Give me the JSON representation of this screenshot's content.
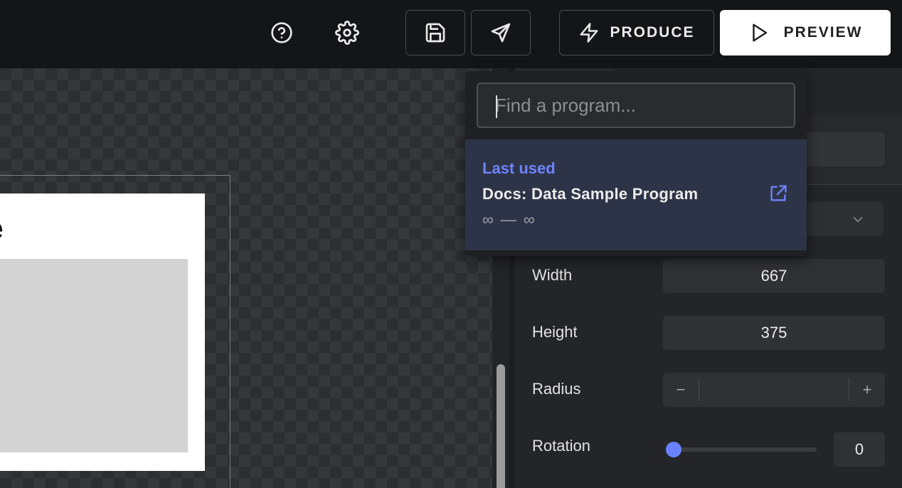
{
  "toolbar": {
    "produce_label": "PRODUCE",
    "preview_label": "PREVIEW"
  },
  "canvas": {
    "card_title_partial": "e"
  },
  "popover": {
    "search_placeholder": "Find a program...",
    "result": {
      "tag": "Last used",
      "name": "Docs: Data Sample Program",
      "range": "∞ — ∞"
    }
  },
  "properties": {
    "width_label": "Width",
    "width_value": "667",
    "height_label": "Height",
    "height_value": "375",
    "radius_label": "Radius",
    "radius_minus": "−",
    "radius_plus": "+",
    "rotation_label": "Rotation",
    "rotation_value": "0"
  },
  "colors": {
    "accent": "#6d84ff",
    "topbar_bg": "#141517",
    "panel_bg": "#242528"
  },
  "icons": [
    "help-icon",
    "gear-icon",
    "save-icon",
    "send-icon",
    "lightning-icon",
    "play-icon",
    "external-link-icon",
    "chevron-down-icon"
  ]
}
